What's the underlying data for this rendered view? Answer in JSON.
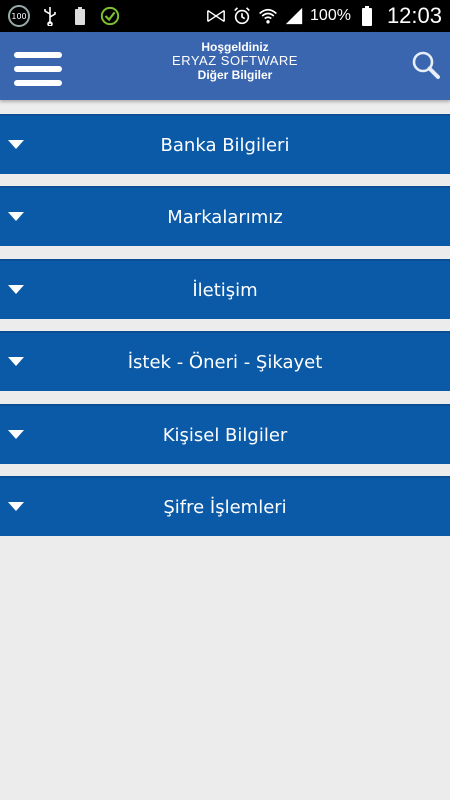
{
  "status_bar": {
    "left_icons": [
      "battery-100-badge-icon",
      "usb-icon",
      "battery-100-small-icon",
      "check-circle-icon"
    ],
    "badge_text": "100",
    "small_battery_text": "100",
    "right_icons": [
      "nfc-icon",
      "alarm-icon",
      "wifi-icon",
      "signal-icon",
      "battery-icon"
    ],
    "battery_percent": "100%",
    "time": "12:03"
  },
  "header": {
    "line1": "Hoşgeldiniz",
    "line2": "ERYAZ SOFTWARE",
    "line3": "Diğer Bilgiler",
    "menu_icon": "hamburger-menu-icon",
    "search_icon": "search-icon",
    "background_color": "#3a66b0"
  },
  "accordion": {
    "item_color": "#0b5aa8",
    "items": [
      {
        "label": "Banka Bilgileri"
      },
      {
        "label": "Markalarımız"
      },
      {
        "label": "İletişim"
      },
      {
        "label": "İstek - Öneri - Şikayet"
      },
      {
        "label": "Kişisel Bilgiler"
      },
      {
        "label": "Şifre İşlemleri"
      }
    ]
  }
}
